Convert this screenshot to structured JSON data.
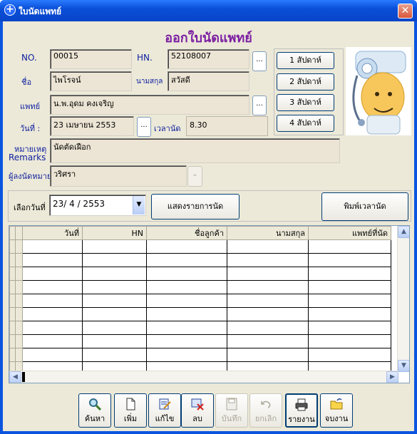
{
  "window": {
    "title": "ใบนัดแพทย์",
    "close_glyph": "✕"
  },
  "form": {
    "heading": "ออกใบนัดแพทย์",
    "no_label": "NO.",
    "no_value": "00015",
    "hn_label": "HN.",
    "hn_value": "52108007",
    "name_label": "ชื่อ",
    "name_value": "ไพโรจน์",
    "surname_label": "นามสกุล",
    "surname_value": "สวัสดี",
    "doctor_label": "แพทย์",
    "doctor_value": "น.พ.อุดม คงเจริญ",
    "date_label": "วันที่ :",
    "date_value": "23 เมษายน 2553",
    "time_label": "เวลานัด",
    "time_value": "8.30",
    "remark_label_th": "หมายเหตุ",
    "remark_label_en": "Remarks",
    "remark_value": "นัดตัดเฝือก",
    "recorder_label": "ผู้ลงนัดหมาย",
    "recorder_value": "วริศรา",
    "ellipsis": "..."
  },
  "weeks": [
    "1 สัปดาห์",
    "2 สัปดาห์",
    "3 สัปดาห์",
    "4 สัปดาห์"
  ],
  "filter": {
    "label": "เลือกวันที่",
    "date_value": "23/ 4 / 2553",
    "show_button": "แสดงรายการนัด",
    "print_button": "พิมพ์เวลานัด"
  },
  "grid": {
    "columns": [
      "วันที่",
      "HN",
      "ชื่อลูกค้า",
      "นามสกุล",
      "แพทย์ที่นัด"
    ],
    "row_count": 10
  },
  "toolbar": {
    "search": "ค้นหา",
    "add": "เพิ่ม",
    "edit": "แก้ไข",
    "delete": "ลบ",
    "save": "บันทึก",
    "cancel": "ยกเลิก",
    "report": "รายงาน",
    "exit": "จบงาน"
  },
  "colors": {
    "heading": "#7b1fa2",
    "label": "#1020a0",
    "titlebar": "#0a4fd8"
  }
}
